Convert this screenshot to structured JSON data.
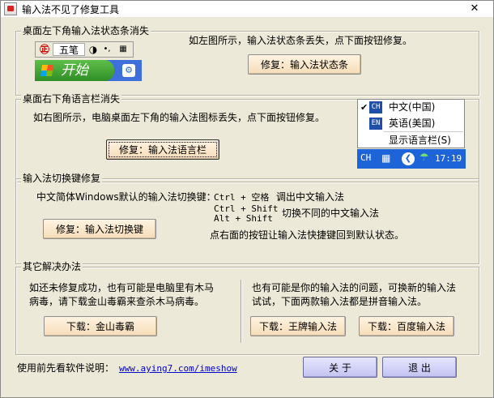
{
  "window": {
    "title": "输入法不见了修复工具",
    "close_label": "✕"
  },
  "section_status": {
    "title": "桌面左下角输入法状态条消失",
    "desc": "如左图所示，输入法状态条丢失，点下面按钮修复。",
    "button": "修复：输入法状态条",
    "illus": {
      "ime_name": "五笔",
      "start_label": "开始"
    }
  },
  "section_langbar": {
    "title": "桌面右下角语言栏消失",
    "desc": "如右图所示，电脑桌面左下角的输入法图标丢失，点下面按钮修复。",
    "button": "修复：输入法语言栏",
    "menu": [
      {
        "badge": "CH",
        "label": "中文(中国)",
        "checked": true
      },
      {
        "badge": "EN",
        "label": "英语(美国)",
        "checked": false
      },
      {
        "badge": "",
        "label": "显示语言栏(S)",
        "checked": false
      }
    ],
    "tray": {
      "lang": "CH",
      "time": "17:19"
    }
  },
  "section_hotkey": {
    "title": "输入法切换键修复",
    "desc": "中文简体Windows默认的输入法切换键：",
    "keys": [
      {
        "combo": "Ctrl + 空格",
        "action": "调出中文输入法"
      },
      {
        "combo": "Ctrl + Shift",
        "action": ""
      },
      {
        "combo": "Alt  + Shift",
        "action": "切换不同的中文输入法"
      }
    ],
    "note": "点右面的按钮让输入法快捷键回到默认状态。",
    "button": "修复：输入法切换键"
  },
  "section_other": {
    "title": "其它解决办法",
    "left_line1": "如还未修复成功，也有可能是电脑里有木马",
    "left_line2": "病毒，请下载金山毒霸来查杀木马病毒。",
    "left_button": "下载：金山毒霸",
    "right_line1": "也有可能是你的输入法的问题，可换新的输入法",
    "right_line2": "试试，下面两款输入法都是拼音输入法。",
    "btn_wangpai": "下载：王牌输入法",
    "btn_baidu": "下载：百度输入法"
  },
  "footer": {
    "label": "使用前先看软件说明：",
    "link": "www.aying7.com/imeshow",
    "about": "关 于",
    "exit": "退 出"
  }
}
